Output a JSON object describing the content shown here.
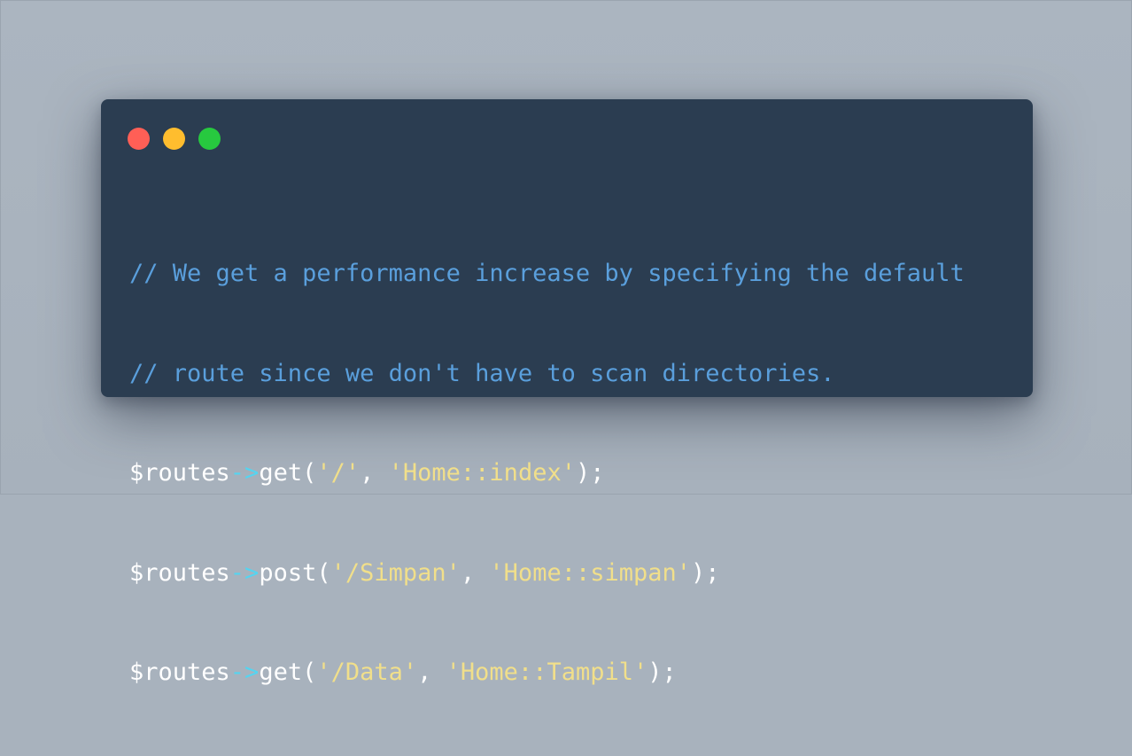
{
  "window_controls": {
    "close_color": "#ff5f56",
    "minimize_color": "#ffbd2e",
    "zoom_color": "#27c93f"
  },
  "colors": {
    "background": "#a8b2bd",
    "window": "#2b3d51",
    "comment": "#5a9fdc",
    "operator": "#55d4f0",
    "string": "#f1df8a",
    "text": "#ffffff"
  },
  "code": {
    "comment1": "// We get a performance increase by specifying the default",
    "comment2": "// route since we don't have to scan directories.",
    "line3": {
      "var": "$routes",
      "arrow": "->",
      "method": "get(",
      "arg1": "'/'",
      "sep": ", ",
      "arg2": "'Home::index'",
      "end": ");"
    },
    "line4": {
      "var": "$routes",
      "arrow": "->",
      "method": "post(",
      "arg1": "'/Simpan'",
      "sep": ", ",
      "arg2": "'Home::simpan'",
      "end": ");"
    },
    "line5": {
      "var": "$routes",
      "arrow": "->",
      "method": "get(",
      "arg1": "'/Data'",
      "sep": ", ",
      "arg2": "'Home::Tampil'",
      "end": ");"
    }
  }
}
